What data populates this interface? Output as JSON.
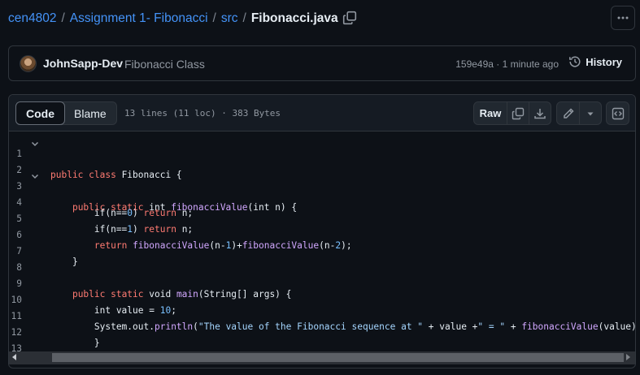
{
  "breadcrumb": {
    "owner": "cen4802",
    "repo": "Assignment 1- Fibonacci",
    "folder": "src",
    "file": "Fibonacci.java",
    "separator": "/"
  },
  "commit": {
    "author": "JohnSapp-Dev",
    "message": "Fibonacci Class",
    "meta": "159e49a · 1 minute ago",
    "history_label": "History"
  },
  "file_header": {
    "tabs": [
      "Code",
      "Blame"
    ],
    "active_tab": "Code",
    "info": "13 lines (11 loc) · 383 Bytes",
    "raw_label": "Raw"
  },
  "code_lines": [
    {
      "n": "1",
      "fold": true
    },
    {
      "n": "2",
      "fold": false
    },
    {
      "n": "3",
      "fold": true
    },
    {
      "n": "4",
      "fold": false
    },
    {
      "n": "5",
      "fold": false
    },
    {
      "n": "6",
      "fold": false
    },
    {
      "n": "7",
      "fold": false
    },
    {
      "n": "8",
      "fold": false
    },
    {
      "n": "9",
      "fold": false
    },
    {
      "n": "10",
      "fold": false
    },
    {
      "n": "11",
      "fold": false
    },
    {
      "n": "12",
      "fold": false
    },
    {
      "n": "13",
      "fold": false
    }
  ],
  "code_tokens": {
    "l1": [
      "public class",
      " Fibonacci {"
    ],
    "l3": [
      "    ",
      "public static",
      " int ",
      "fibonacciValue",
      "(int n) {"
    ],
    "l4": [
      "        if(n==",
      "0",
      ") ",
      "return",
      " n;"
    ],
    "l5": [
      "        if(n==",
      "1",
      ") ",
      "return",
      " n;"
    ],
    "l6": [
      "        ",
      "return",
      " ",
      "fibonacciValue",
      "(n-",
      "1",
      ")+",
      "fibonacciValue",
      "(n-",
      "2",
      ");"
    ],
    "l7": [
      "    }"
    ],
    "l9": [
      "    ",
      "public static",
      " void ",
      "main",
      "(String[] args) {"
    ],
    "l10": [
      "        int value = ",
      "10",
      ";"
    ],
    "l11": [
      "        System.out.",
      "println",
      "(",
      "\"The value of the Fibonacci sequence at \"",
      " + value +",
      "\" = \"",
      " + ",
      "fibonacciValue",
      "(value));"
    ],
    "l12": [
      "        }"
    ],
    "l13": [
      "    }"
    ]
  },
  "colors": {
    "link": "#4493f8",
    "keyword": "#ff7b72",
    "function": "#d2a8ff",
    "number": "#79c0ff",
    "string": "#a5d6ff",
    "background": "#0d1117"
  }
}
